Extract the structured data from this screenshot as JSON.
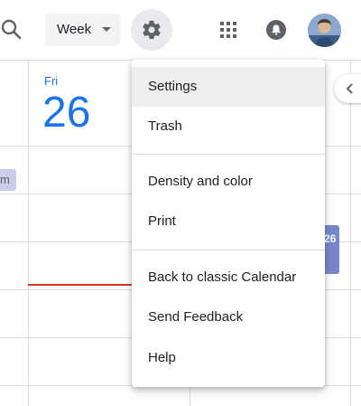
{
  "header": {
    "view_select": {
      "label": "Week"
    },
    "icons": {
      "search": "search-icon",
      "settings": "gear-icon",
      "apps": "apps-grid-icon",
      "notifications": "bell-icon",
      "avatar": "user-avatar"
    }
  },
  "calendar": {
    "day": {
      "name": "Fri",
      "number": "26"
    },
    "events": [
      {
        "text": "m",
        "color": "#c8cde9"
      },
      {
        "text": "26",
        "color": "#7986cb"
      }
    ],
    "now_line_color": "#d93025",
    "accent": "#1a73e8"
  },
  "settings_menu": {
    "items": [
      {
        "label": "Settings",
        "active": true
      },
      {
        "label": "Trash"
      },
      {
        "label": "Density and color"
      },
      {
        "label": "Print"
      },
      {
        "label": "Back to classic Calendar"
      },
      {
        "label": "Send Feedback"
      },
      {
        "label": "Help"
      }
    ]
  }
}
